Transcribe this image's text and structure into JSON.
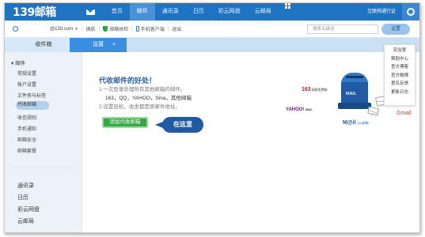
{
  "topnav": {
    "logo": "139邮箱",
    "items": [
      "首页",
      "邮件",
      "通讯录",
      "日历",
      "彩云网盘",
      "云邮局"
    ],
    "active_index": 1,
    "right_link": "互联网通行证"
  },
  "userbar": {
    "email": "@139.com",
    "switch": "换肤",
    "experience": "邮箱体检",
    "client": "手机客户端",
    "logout": "退出",
    "search_placeholder": "搜索关键词",
    "settings_button": "设置"
  },
  "tabs": {
    "inbox": "收件箱",
    "settings": "设置",
    "close": "×"
  },
  "sidebar": {
    "heading": "▾ 邮件",
    "items": [
      "常规设置",
      "帐户设置",
      "文件夹与标签",
      "代收邮箱",
      "收信规则",
      "手机通知",
      "邮箱安全",
      "邮箱套餐"
    ],
    "active_index": 3,
    "bottom_items": [
      "通讯录",
      "日历",
      "彩云网盘",
      "云邮局"
    ]
  },
  "main": {
    "headline": "代收邮件的好处！",
    "line1": "1.一次登录处理所有其他邮箱的邮件。",
    "line2": "163，QQ，YAHOO，Sina，其他邮箱",
    "line3": "2.设置轻松，收发都是原邮件地址。",
    "add_button": "添加代收邮箱",
    "callout": "在这里"
  },
  "illustration": {
    "logo_163": "163",
    "logo_163_sub": "网易免费邮",
    "logo_yahoo": "YAHOO!",
    "logo_yahoo_sub": "MAIL",
    "logo_gmail": "Gmail",
    "logo_mail": "M@il",
    "logo_mail_sub": "QQ邮箱",
    "mailbox_text": "MAIL"
  },
  "dropdown": {
    "items": [
      "实验室",
      "帮助中心",
      "官方博客",
      "官方微博",
      "意见反馈",
      "更新日志"
    ]
  }
}
